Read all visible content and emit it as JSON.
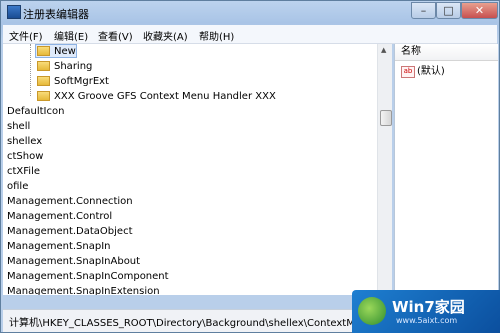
{
  "window": {
    "title": "注册表编辑器",
    "buttons": {
      "minimize": "–",
      "maximize": "□",
      "close": "✕"
    }
  },
  "menu": [
    "文件(F)",
    "编辑(E)",
    "查看(V)",
    "收藏夹(A)",
    "帮助(H)"
  ],
  "tree": {
    "children": [
      "New",
      "Sharing",
      "SoftMgrExt",
      "XXX Groove GFS Context Menu Handler XXX"
    ],
    "keys": [
      "DefaultIcon",
      "shell",
      "shellex",
      "ctShow",
      "ctXFile",
      "ofile",
      "Management.Connection",
      "Management.Control",
      "Management.DataObject",
      "Management.SnapIn",
      "Management.SnapInAbout",
      "Management.SnapInComponent",
      "Management.SnapInExtension"
    ]
  },
  "list": {
    "column_header": "名称",
    "rows": [
      {
        "icon": "string-value-icon",
        "name": "(默认)"
      }
    ]
  },
  "status": {
    "path": "计算机\\HKEY_CLASSES_ROOT\\Directory\\Background\\shellex\\ContextMenuHa"
  },
  "watermark": {
    "title": "Win7家园",
    "url": "www.5aixt.com"
  }
}
